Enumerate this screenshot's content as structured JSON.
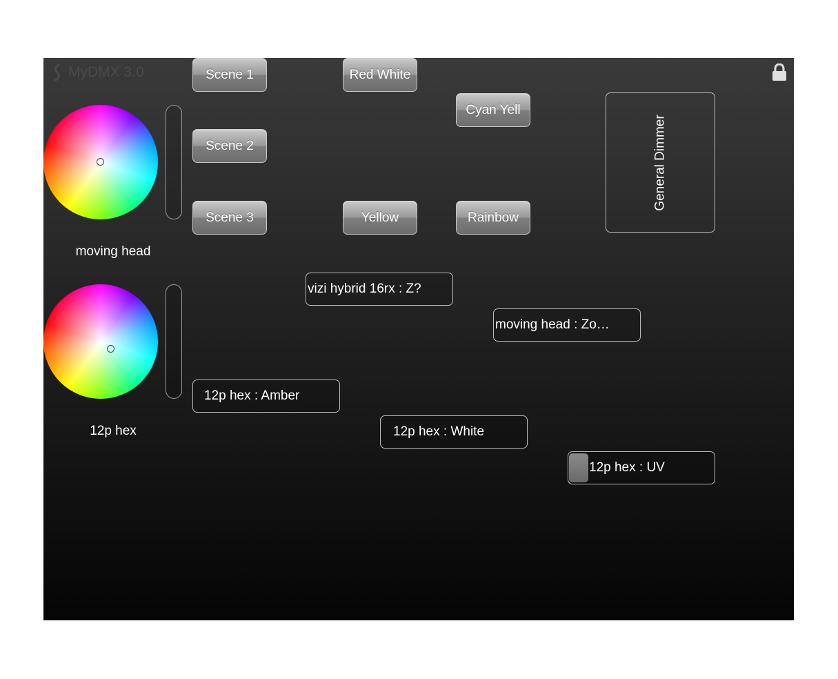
{
  "app": {
    "title": "MyDMX 3.0"
  },
  "fixtures": [
    {
      "label": "moving head"
    },
    {
      "label": "12p hex"
    }
  ],
  "scenes": [
    "Scene 1",
    "Scene 2",
    "Scene 3",
    "Red White",
    "Cyan Yell",
    "Yellow",
    "Rainbow"
  ],
  "faders": [
    {
      "label": "vizi hybrid 16rx : Z?",
      "level": 0
    },
    {
      "label": "moving head : Zo…",
      "level": 0
    },
    {
      "label": "12p hex : Amber",
      "level": 0
    },
    {
      "label": "12p hex : White",
      "level": 0
    },
    {
      "label": "12p hex : UV",
      "level": 0.13
    }
  ],
  "dimmer": {
    "label": "General Dimmer"
  },
  "icons": {
    "logo": "mydmx-logo-icon",
    "lock": "lock-icon"
  },
  "colors": {
    "background_top": "#3a3a3a",
    "background_bottom": "#050505",
    "button": "#9a9a9a"
  }
}
